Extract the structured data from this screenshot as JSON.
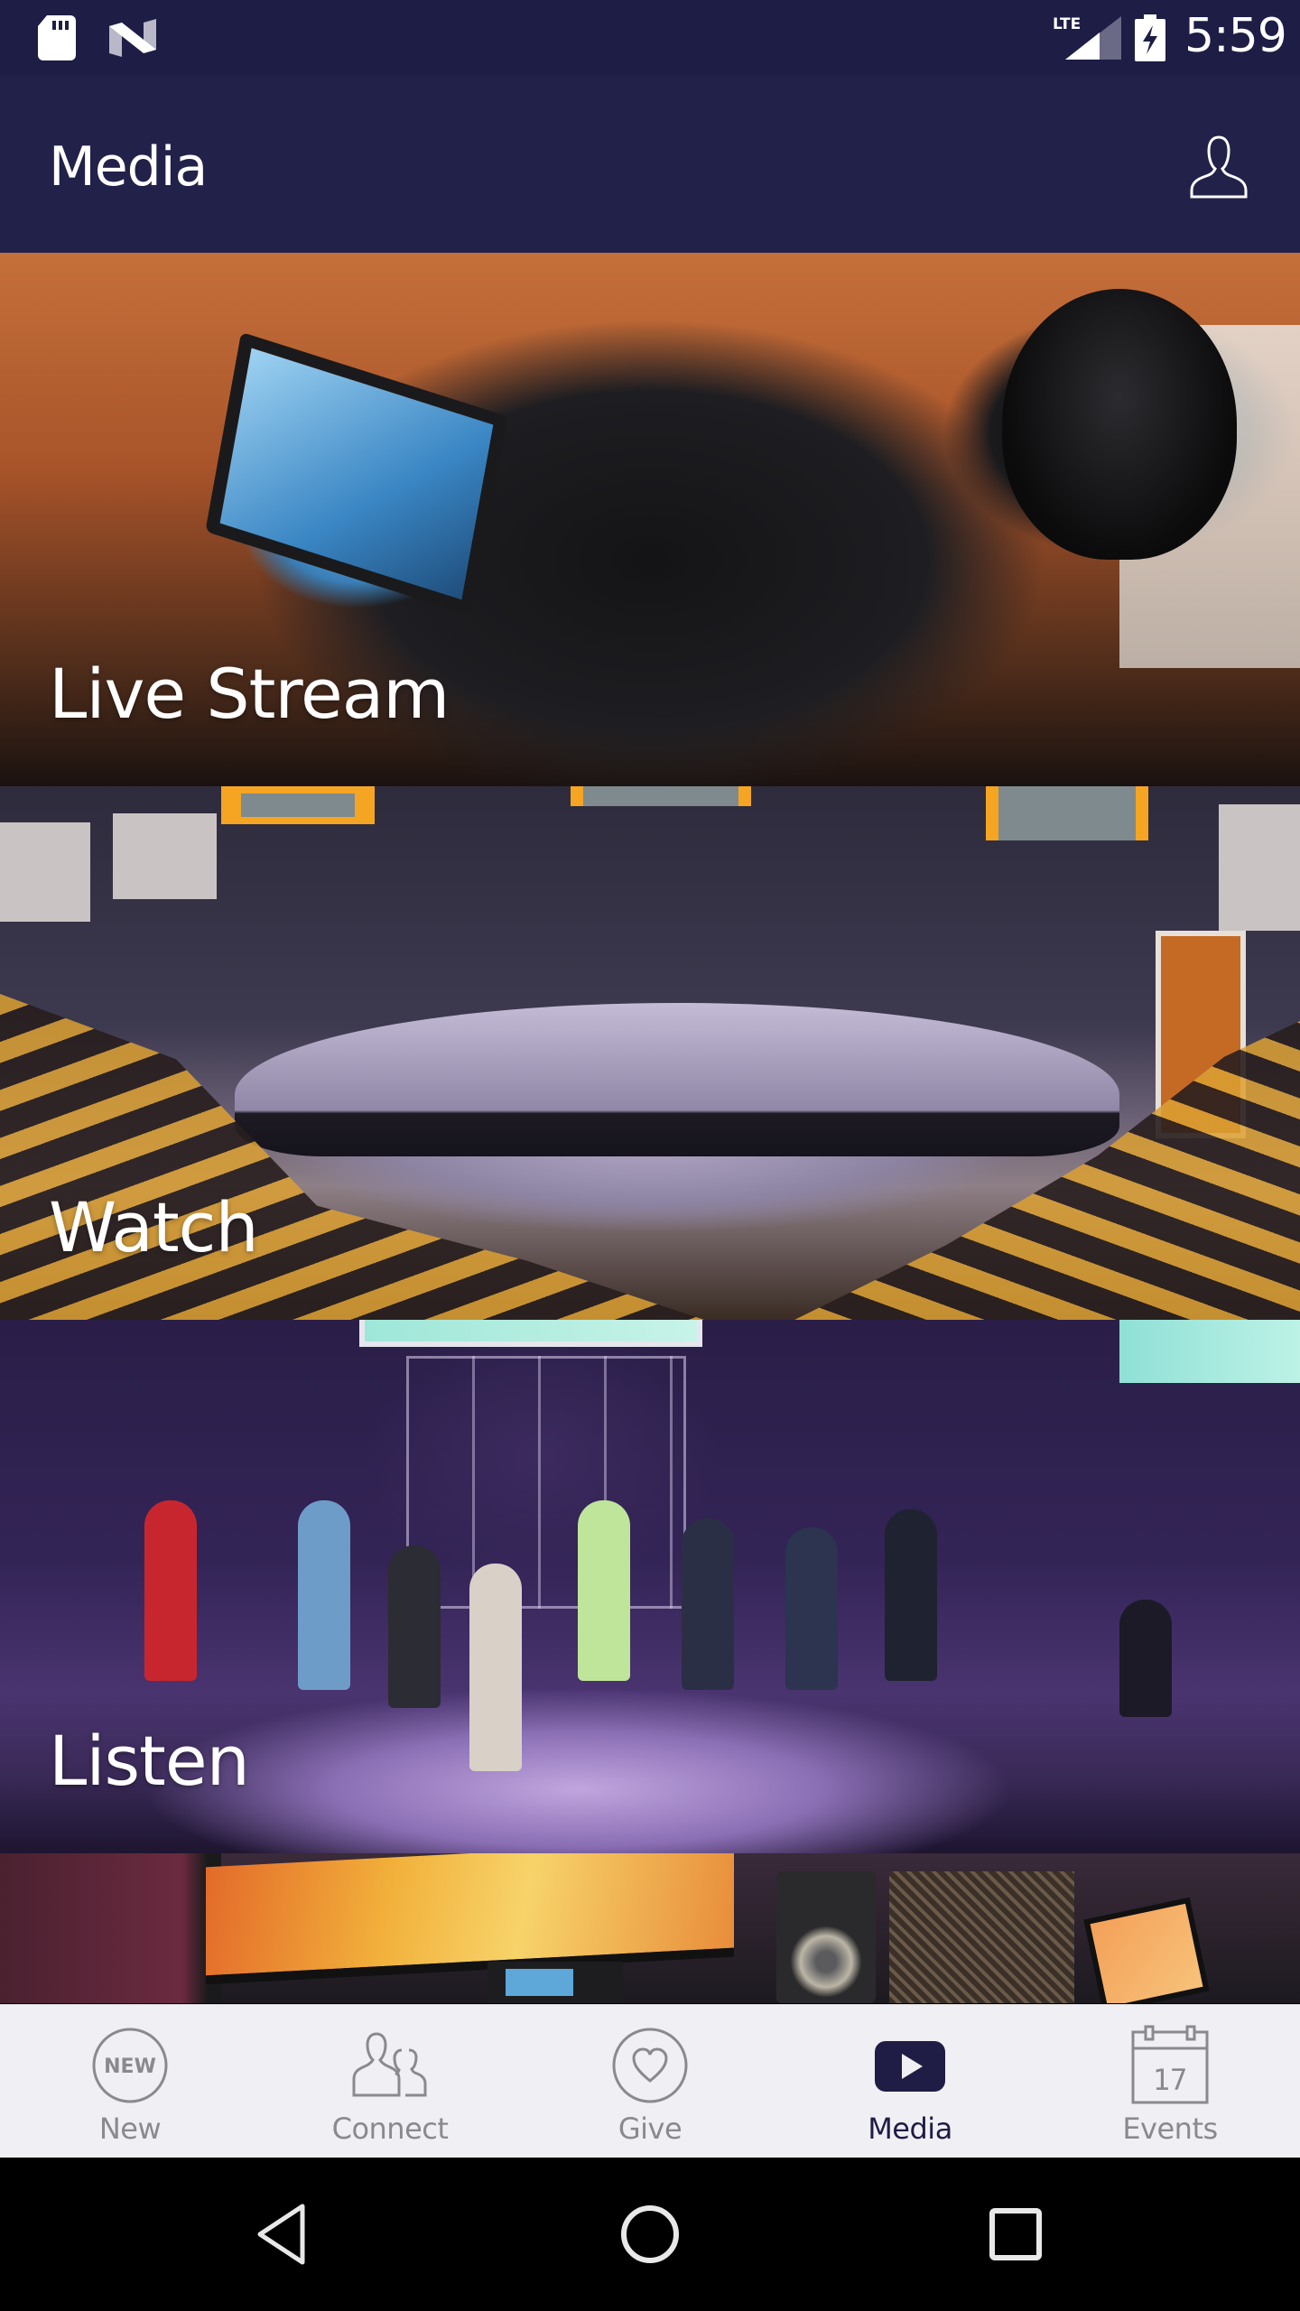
{
  "status_bar": {
    "time": "5:59",
    "network": "LTE",
    "left_icons": [
      "sd-card-icon",
      "android-n-icon"
    ],
    "right_icons": [
      "lte-signal-icon",
      "battery-charging-icon"
    ]
  },
  "app_bar": {
    "title": "Media",
    "action_icon": "profile-icon"
  },
  "cards": [
    {
      "label": "Live Stream",
      "image": "video camera filming a church service"
    },
    {
      "label": "Watch",
      "image": "church sanctuary with speaker on stage and congregation"
    },
    {
      "label": "Listen",
      "image": "worship band performing on stage"
    },
    {
      "label": "",
      "image": "audio mixing studio with monitors and speakers"
    }
  ],
  "bottom_nav": {
    "items": [
      {
        "label": "New",
        "icon": "new-badge-icon",
        "active": false
      },
      {
        "label": "Connect",
        "icon": "people-icon",
        "active": false
      },
      {
        "label": "Give",
        "icon": "heart-icon",
        "active": false
      },
      {
        "label": "Media",
        "icon": "play-icon",
        "active": true
      },
      {
        "label": "Events",
        "icon": "calendar-icon",
        "active": false
      }
    ],
    "calendar_day": "17",
    "new_badge_text": "NEW"
  },
  "colors": {
    "status_bar": "#1e1d45",
    "app_bar": "#22214a",
    "active_nav": "#1f1d45",
    "inactive_nav": "#8a8a8e",
    "bottom_nav_bg": "#f0f0f4"
  }
}
